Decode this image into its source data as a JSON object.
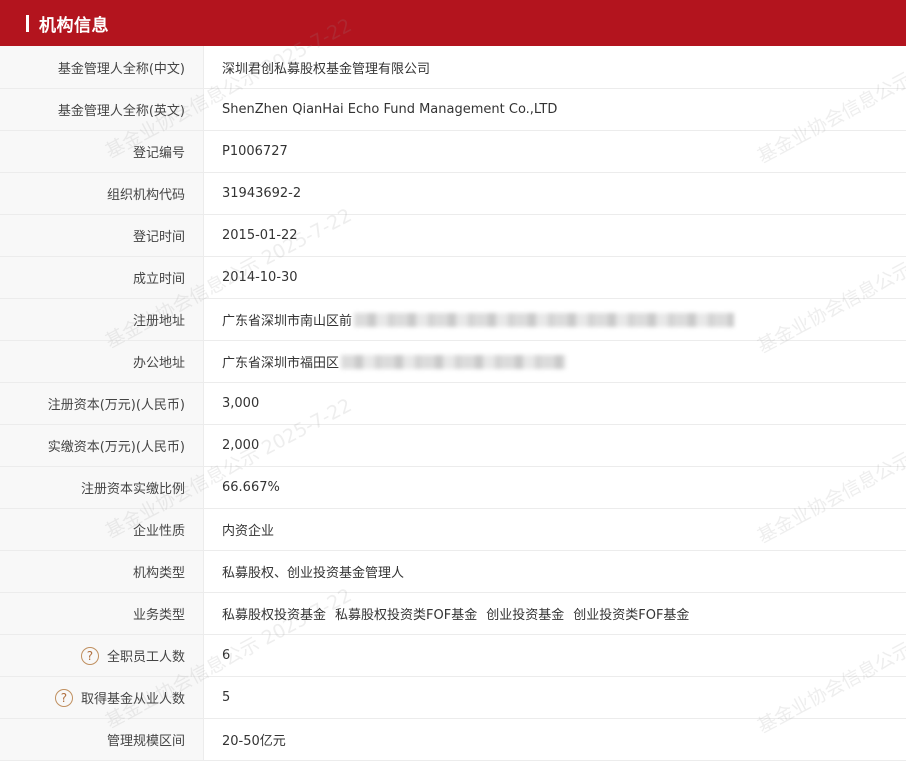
{
  "header": {
    "title": "机构信息"
  },
  "rows": [
    {
      "label": "基金管理人全称(中文)",
      "value": "深圳君创私募股权基金管理有限公司"
    },
    {
      "label": "基金管理人全称(英文)",
      "value": "ShenZhen QianHai Echo Fund Management Co.,LTD"
    },
    {
      "label": "登记编号",
      "value": "P1006727"
    },
    {
      "label": "组织机构代码",
      "value": "31943692-2"
    },
    {
      "label": "登记时间",
      "value": "2015-01-22"
    },
    {
      "label": "成立时间",
      "value": "2014-10-30"
    },
    {
      "label": "注册地址",
      "value": "广东省深圳市南山区前"
    },
    {
      "label": "办公地址",
      "value": "广东省深圳市福田区"
    },
    {
      "label": "注册资本(万元)(人民币)",
      "value": "3,000"
    },
    {
      "label": "实缴资本(万元)(人民币)",
      "value": "2,000"
    },
    {
      "label": "注册资本实缴比例",
      "value": "66.667%"
    },
    {
      "label": "企业性质",
      "value": "内资企业"
    },
    {
      "label": "机构类型",
      "value": "私募股权、创业投资基金管理人"
    },
    {
      "label": "业务类型",
      "values": [
        "私募股权投资基金",
        "私募股权投资类FOF基金",
        "创业投资基金",
        "创业投资类FOF基金"
      ]
    },
    {
      "label": "全职员工人数",
      "value": "6",
      "help": "?"
    },
    {
      "label": "取得基金从业人数",
      "value": "5",
      "help": "?"
    },
    {
      "label": "管理规模区间",
      "value": "20-50亿元"
    }
  ],
  "watermark": {
    "text_a": "基金业协会信息公示 2025-7-22",
    "text_b": "基金业协会信息公示"
  }
}
